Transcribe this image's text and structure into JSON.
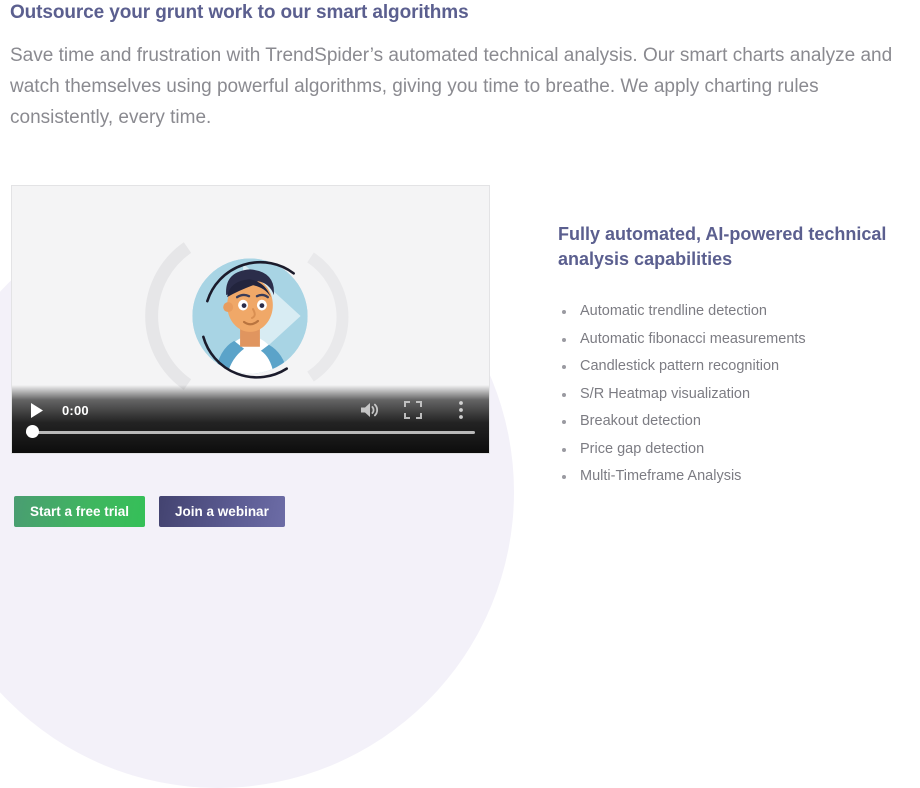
{
  "hero": {
    "headline": "Outsource your grunt work to our smart algorithms",
    "paragraph": "Save time and frustration with TrendSpider’s automated technical analysis. Our smart charts analyze and watch themselves using powerful algorithms, giving you time to breathe. We apply charting rules consistently, every time."
  },
  "video": {
    "current_time": "0:00",
    "progress_percent": 0,
    "controls": {
      "play_label": "play-button",
      "volume_label": "mute-button",
      "fullscreen_label": "fullscreen-button",
      "menu_label": "more-options-button",
      "scrubber_label": "seek-slider"
    },
    "poster": {
      "description": "cartoon man avatar with play triangle and circular arcs"
    }
  },
  "side_panel": {
    "title": "Fully automated, AI-powered technical analysis capabilities",
    "features": [
      "Automatic trendline detection",
      "Automatic fibonacci measurements",
      "Candlestick pattern recognition",
      "S/R Heatmap visualization",
      "Breakout detection",
      "Price gap detection",
      "Multi-Timeframe Analysis"
    ]
  },
  "cta": {
    "primary_label": "Start a free trial",
    "secondary_label": "Join a webinar"
  },
  "colors": {
    "heading": "#5b5f8f",
    "body_text": "#8a8a90",
    "feature_text": "#7c7c83",
    "deco_circle": "#f3f1f9",
    "cta_primary": "#3fb65f",
    "cta_secondary": "#5c5c93",
    "page_background": "#ffffff",
    "video_background": "#f4f4f5"
  }
}
